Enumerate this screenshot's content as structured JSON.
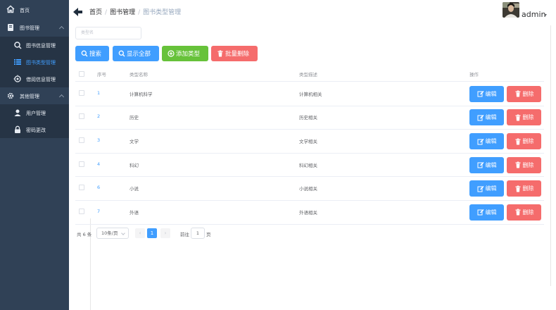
{
  "sidebar": {
    "items": [
      {
        "label": "首页",
        "icon": "home-icon"
      },
      {
        "label": "图书管理",
        "icon": "book-icon"
      },
      {
        "label": "图书信息管理",
        "icon": "search-icon"
      },
      {
        "label": "图书类型管理",
        "icon": "list-icon"
      },
      {
        "label": "借阅信息管理",
        "icon": "target-icon"
      },
      {
        "label": "其他管理",
        "icon": "gear-icon"
      },
      {
        "label": "用户管理",
        "icon": "user-icon"
      },
      {
        "label": "密码更改",
        "icon": "lock-icon"
      }
    ]
  },
  "header": {
    "breadcrumb": [
      "首页",
      "图书管理",
      "图书类型管理"
    ],
    "separator": "/",
    "username": "admin"
  },
  "toolbar": {
    "search_placeholder": "类型名",
    "search_label": "搜索",
    "show_all_label": "显示全部",
    "add_label": "添加类型",
    "batch_delete_label": "批量删除"
  },
  "table": {
    "columns": [
      "序号",
      "类型名称",
      "类型描述",
      "操作"
    ],
    "rows": [
      {
        "id": "1",
        "name": "计算机科学",
        "desc": "计算机相关"
      },
      {
        "id": "2",
        "name": "历史",
        "desc": "历史相关"
      },
      {
        "id": "3",
        "name": "文学",
        "desc": "文学相关"
      },
      {
        "id": "4",
        "name": "科幻",
        "desc": "科幻相关"
      },
      {
        "id": "6",
        "name": "小说",
        "desc": "小说相关"
      },
      {
        "id": "7",
        "name": "外语",
        "desc": "外语相关"
      }
    ],
    "edit_label": "编辑",
    "delete_label": "删除"
  },
  "pagination": {
    "total": "共 6 条",
    "page_size": "10条/页",
    "prev": "‹",
    "current": "1",
    "next": "›",
    "goto_label": "前往",
    "goto_value": "1",
    "page_suffix": "页"
  },
  "colors": {
    "sidebar_bg": "#304156",
    "primary": "#409eff",
    "success": "#67c23a",
    "danger": "#f56c6c"
  }
}
